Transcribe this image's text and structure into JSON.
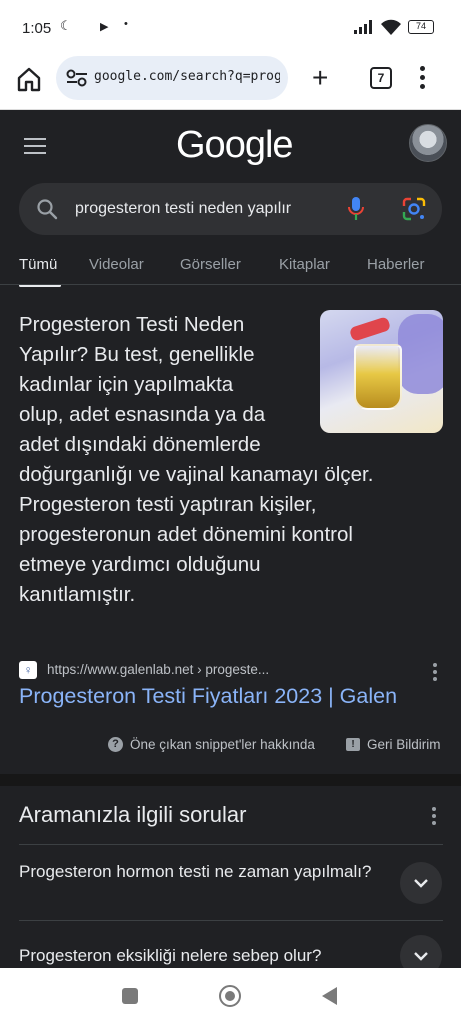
{
  "status_bar": {
    "time": "1:05",
    "battery": "74"
  },
  "browser": {
    "url": "google.com/search?q=progesteron",
    "tab_count": "7"
  },
  "google": {
    "logo": "Google",
    "search_query": "progesteron testi neden yapılır",
    "tabs": [
      "Tümü",
      "Videolar",
      "Görseller",
      "Kitaplar",
      "Haberler"
    ],
    "active_tab": "Tümü"
  },
  "snippet": {
    "line1": "Progesteron Testi Neden",
    "line2": "Yapılır? Bu test, genellikle",
    "line3": "kadınlar için yapılmakta",
    "line4_plain": "olup, ",
    "line4_hl": "adet esnasında ya da",
    "line5_hl": "adet dışındaki dönemlerde",
    "line6_hl": "doğurganlığı ve vajinal kanamayı ölçer",
    "line6_end": ".",
    "line7": "Progesteron testi yaptıran kişiler,",
    "line8": "progesteronun adet dönemini kontrol",
    "line9": "etmeye yardımcı olduğunu",
    "line10": "kanıtlamıştır.",
    "source_url": "https://www.galenlab.net › progeste...",
    "result_title": "Progesteron Testi Fiyatları 2023 | Galen",
    "help_label": "Öne çıkan snippet'ler hakkında",
    "feedback_label": "Geri Bildirim"
  },
  "related": {
    "title": "Aramanızla ilgili sorular",
    "questions": [
      "Progesteron hormon testi ne zaman yapılmalı?",
      "Progesteron eksikliği nelere sebep olur?"
    ]
  },
  "colors": {
    "page_bg": "#202124",
    "link": "#8ab4f8",
    "highlight": "#3b4a6b"
  }
}
